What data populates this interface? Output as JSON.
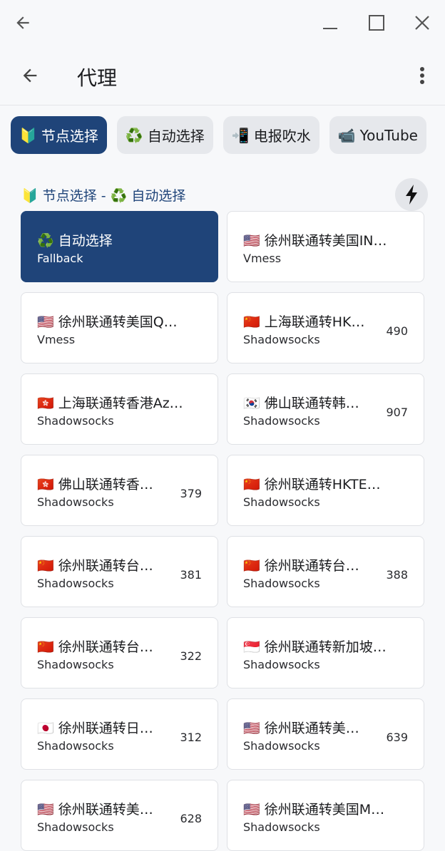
{
  "header": {
    "title": "代理"
  },
  "tabs": [
    {
      "emoji": "🔰",
      "label": "节点选择"
    },
    {
      "emoji": "♻️",
      "label": "自动选择"
    },
    {
      "emoji": "📲",
      "label": "电报吹水"
    },
    {
      "emoji": "📹",
      "label": "YouTube"
    }
  ],
  "group": {
    "title": "🔰 节点选择 - ♻️ 自动选择"
  },
  "proxies": [
    {
      "name": "♻️ 自动选择",
      "type": "Fallback",
      "delay": ""
    },
    {
      "name": "🇺🇸 徐州联通转美国IN…",
      "type": "Vmess",
      "delay": ""
    },
    {
      "name": "🇺🇸 徐州联通转美国Q…",
      "type": "Vmess",
      "delay": ""
    },
    {
      "name": "🇨🇳 上海联通转HK…",
      "type": "Shadowsocks",
      "delay": "490"
    },
    {
      "name": "🇭🇰 上海联通转香港Az…",
      "type": "Shadowsocks",
      "delay": ""
    },
    {
      "name": "🇰🇷 佛山联通转韩…",
      "type": "Shadowsocks",
      "delay": "907"
    },
    {
      "name": "🇭🇰 佛山联通转香…",
      "type": "Shadowsocks",
      "delay": "379"
    },
    {
      "name": "🇨🇳 徐州联通转HKTE…",
      "type": "Shadowsocks",
      "delay": ""
    },
    {
      "name": "🇨🇳 徐州联通转台…",
      "type": "Shadowsocks",
      "delay": "381"
    },
    {
      "name": "🇨🇳 徐州联通转台…",
      "type": "Shadowsocks",
      "delay": "388"
    },
    {
      "name": "🇨🇳 徐州联通转台…",
      "type": "Shadowsocks",
      "delay": "322"
    },
    {
      "name": "🇸🇬 徐州联通转新加坡…",
      "type": "Shadowsocks",
      "delay": ""
    },
    {
      "name": "🇯🇵 徐州联通转日…",
      "type": "Shadowsocks",
      "delay": "312"
    },
    {
      "name": "🇺🇸 徐州联通转美…",
      "type": "Shadowsocks",
      "delay": "639"
    },
    {
      "name": "🇺🇸 徐州联通转美…",
      "type": "Shadowsocks",
      "delay": "628"
    },
    {
      "name": "🇺🇸 徐州联通转美国M…",
      "type": "Shadowsocks",
      "delay": ""
    }
  ]
}
